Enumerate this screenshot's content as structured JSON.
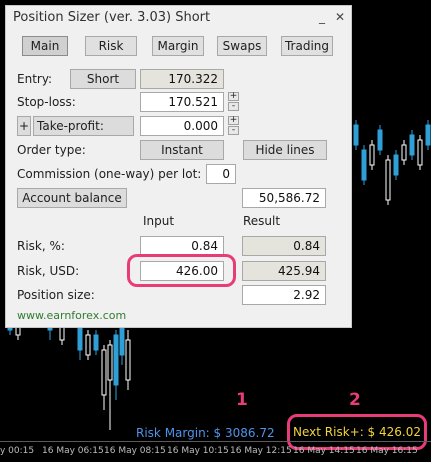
{
  "window": {
    "title": "Position Sizer (ver. 3.03) Short",
    "minimize_glyph": "_",
    "close_glyph": "✕"
  },
  "tabs": [
    {
      "label": "Main",
      "active": true
    },
    {
      "label": "Risk",
      "active": false
    },
    {
      "label": "Margin",
      "active": false
    },
    {
      "label": "Swaps",
      "active": false
    },
    {
      "label": "Trading",
      "active": false
    }
  ],
  "form": {
    "entry_label": "Entry:",
    "entry_direction": "Short",
    "entry_value": "170.322",
    "stop_loss_label": "Stop-loss:",
    "stop_loss_value": "170.521",
    "take_profit_plus": "+",
    "take_profit_label": "Take-profit:",
    "take_profit_value": "0.000",
    "order_type_label": "Order type:",
    "order_type_value": "Instant",
    "hide_lines_label": "Hide lines",
    "commission_label": "Commission (one-way) per lot:",
    "commission_value": "0",
    "account_balance_label": "Account balance",
    "account_balance_value": "50,586.72",
    "input_header": "Input",
    "result_header": "Result",
    "risk_pct_label": "Risk, %:",
    "risk_pct_input": "0.84",
    "risk_pct_result": "0.84",
    "risk_usd_label": "Risk, USD:",
    "risk_usd_input": "426.00",
    "risk_usd_result": "425.94",
    "position_size_label": "Position size:",
    "position_size_value": "2.92",
    "spin_up": "+",
    "spin_down": "-"
  },
  "website": "www.earnforex.com",
  "annotations": {
    "badge_1": "1",
    "badge_2": "2",
    "highlight_color": "#e83c78"
  },
  "chart_overlay": {
    "risk_margin": "Risk Margin: $ 3086.72",
    "next_risk": "Next Risk+: $ 426.02",
    "risk_margin_color": "#4f94e8",
    "next_risk_color": "#f2d33a"
  },
  "time_axis": [
    "y 00:15",
    "16 May 06:15",
    "16 May 08:15",
    "16 May 10:15",
    "16 May 12:15",
    "16 May 14:15",
    "16 May 16:15"
  ],
  "colors": {
    "bull_candle": "#2f9fd8",
    "bear_candle": "#ffffff",
    "background": "#000000"
  }
}
